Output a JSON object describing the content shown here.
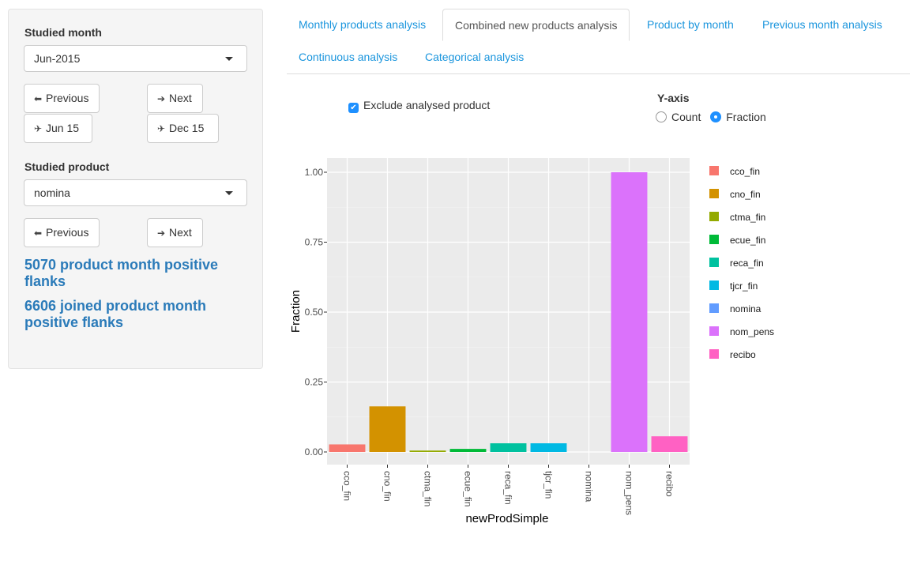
{
  "sidebar": {
    "month_label": "Studied month",
    "month_value": "Jun-2015",
    "prev_label": "Previous",
    "next_label": "Next",
    "jump_start_label": "Jun 15",
    "jump_end_label": "Dec 15",
    "product_label": "Studied product",
    "product_value": "nomina",
    "prod_prev_label": "Previous",
    "prod_next_label": "Next",
    "info1": "5070 product month positive flanks",
    "info2": "6606 joined product month positive flanks"
  },
  "tabs": [
    {
      "label": "Monthly products analysis"
    },
    {
      "label": "Combined new products analysis"
    },
    {
      "label": "Product by month"
    },
    {
      "label": "Previous month analysis"
    },
    {
      "label": "Continuous analysis"
    },
    {
      "label": "Categorical analysis"
    }
  ],
  "controls": {
    "exclude_label": "Exclude analysed product",
    "exclude_checked": true,
    "yaxis_title": "Y-axis",
    "radio_count": "Count",
    "radio_fraction": "Fraction",
    "selected": "Fraction"
  },
  "chart_data": {
    "type": "bar",
    "xlabel": "newProdSimple",
    "ylabel": "Fraction",
    "ylim": [
      0,
      1.0
    ],
    "yticks": [
      "0.00",
      "0.25",
      "0.50",
      "0.75",
      "1.00"
    ],
    "grid": true,
    "legend_position": "right",
    "categories": [
      "cco_fin",
      "cno_fin",
      "ctma_fin",
      "ecue_fin",
      "reca_fin",
      "tjcr_fin",
      "nomina",
      "nom_pens",
      "recibo"
    ],
    "values": [
      0.027,
      0.163,
      0.005,
      0.011,
      0.031,
      0.031,
      0.0,
      1.0,
      0.056
    ],
    "colors": [
      "#f8766d",
      "#d39200",
      "#93aa00",
      "#00ba38",
      "#00c19f",
      "#00b9e3",
      "#619cff",
      "#db72fb",
      "#ff61c3"
    ],
    "legend": [
      "cco_fin",
      "cno_fin",
      "ctma_fin",
      "ecue_fin",
      "reca_fin",
      "tjcr_fin",
      "nomina",
      "nom_pens",
      "recibo"
    ]
  }
}
